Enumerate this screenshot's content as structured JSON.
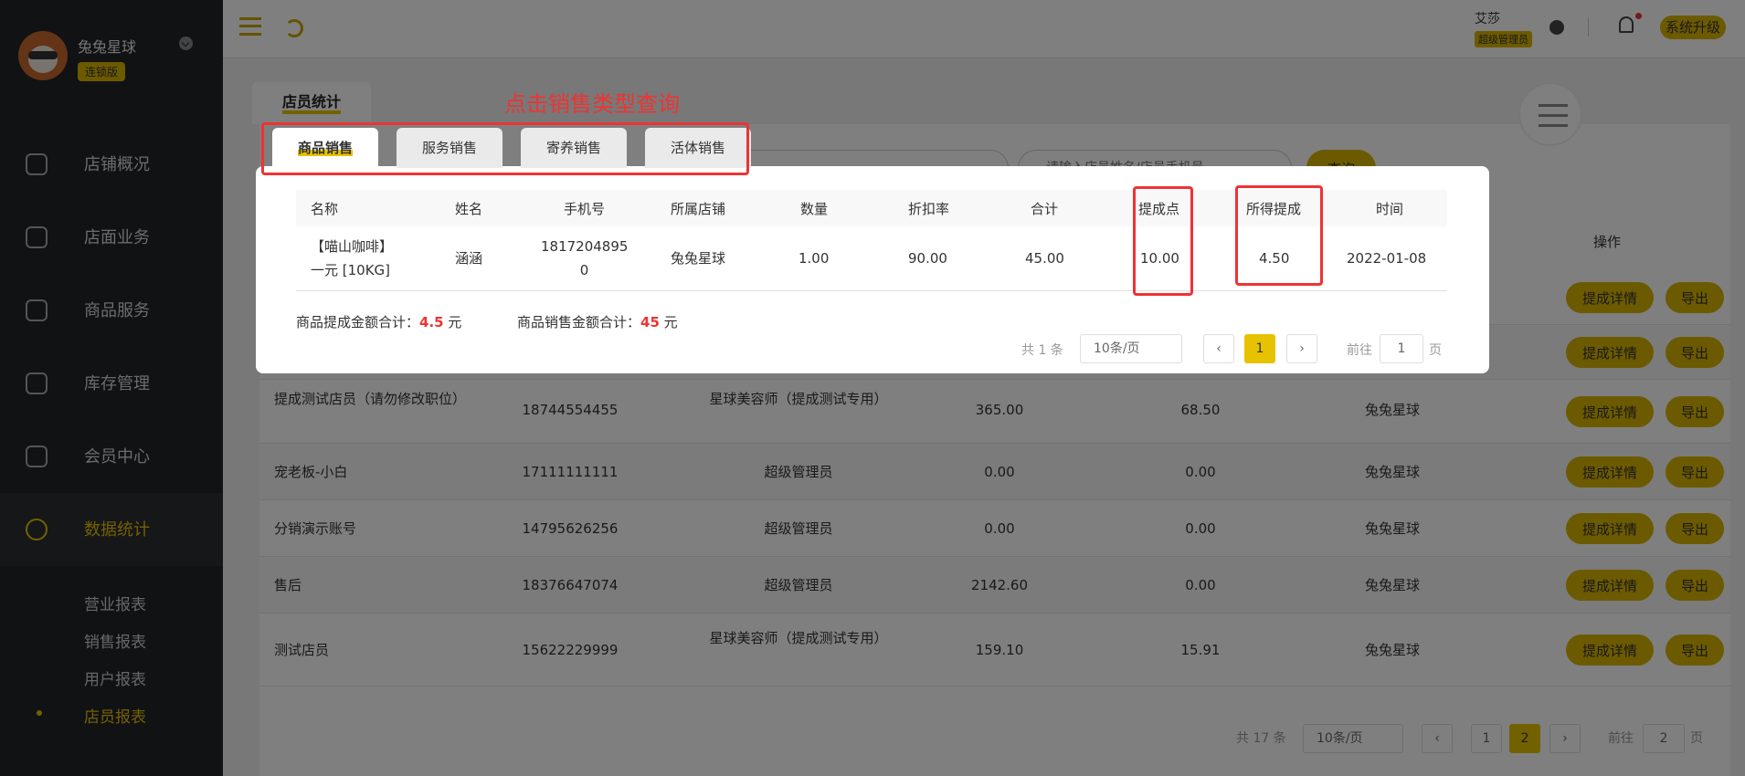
{
  "sidebar": {
    "store_name": "兔兔星球",
    "edition": "连锁版",
    "items": [
      {
        "label": "店铺概况",
        "icon": "monitor-icon"
      },
      {
        "label": "店面业务",
        "icon": "home-icon"
      },
      {
        "label": "商品服务",
        "icon": "bag-icon"
      },
      {
        "label": "库存管理",
        "icon": "box-icon"
      },
      {
        "label": "会员中心",
        "icon": "headset-icon"
      },
      {
        "label": "数据统计",
        "icon": "chart-icon"
      }
    ],
    "sub_items": [
      "营业报表",
      "销售报表",
      "用户报表",
      "店员报表"
    ]
  },
  "topbar": {
    "user_name": "艾莎",
    "user_role": "超级管理员",
    "upgrade_label": "系统升级"
  },
  "main": {
    "tab_label": "店员统计",
    "search_placeholder": "请输入店员姓名/店员手机号",
    "search_label": "查询",
    "col_action": "操作",
    "rows": [
      {
        "name": "",
        "phone": "",
        "role": "",
        "sales": "",
        "commission": "",
        "store": ""
      },
      {
        "name": "",
        "phone": "",
        "role": "",
        "sales": "",
        "commission": "",
        "store": ""
      },
      {
        "name": "提成测试店员（请勿修改职位）",
        "phone": "18744554455",
        "role": "星球美容师（提成测试专用）",
        "sales": "365.00",
        "commission": "68.50",
        "store": "兔兔星球"
      },
      {
        "name": "宠老板-小白",
        "phone": "17111111111",
        "role": "超级管理员",
        "sales": "0.00",
        "commission": "0.00",
        "store": "兔兔星球"
      },
      {
        "name": "分销演示账号",
        "phone": "14795626256",
        "role": "超级管理员",
        "sales": "0.00",
        "commission": "0.00",
        "store": "兔兔星球"
      },
      {
        "name": "售后",
        "phone": "18376647074",
        "role": "超级管理员",
        "sales": "2142.60",
        "commission": "0.00",
        "store": "兔兔星球"
      },
      {
        "name": "测试店员",
        "phone": "15622229999",
        "role": "星球美容师（提成测试专用）",
        "sales": "159.10",
        "commission": "15.91",
        "store": "兔兔星球"
      }
    ],
    "detail_label": "提成详情",
    "export_label": "导出",
    "pager": {
      "total": "共 17 条",
      "size": "10条/页",
      "pages": [
        "1",
        "2"
      ],
      "goto": "前往",
      "goto_value": "2",
      "page_unit": "页"
    }
  },
  "modal": {
    "tabs": [
      "商品销售",
      "服务销售",
      "寄养销售",
      "活体销售"
    ],
    "annotation": "点击销售类型查询",
    "columns": [
      "名称",
      "姓名",
      "手机号",
      "所属店铺",
      "数量",
      "折扣率",
      "合计",
      "提成点",
      "所得提成",
      "时间"
    ],
    "row": {
      "product_line1": "【喵山咖啡】",
      "product_line2": "一元 [10KG]",
      "name": "涵涵",
      "phone_line1": "1817204895",
      "phone_line2": "0",
      "store": "兔兔星球",
      "qty": "1.00",
      "discount": "90.00",
      "total": "45.00",
      "rate": "10.00",
      "commission": "4.50",
      "date": "2022-01-08"
    },
    "sum_commission_label": "商品提成金额合计：",
    "sum_commission_value": "4.5",
    "sum_sales_label": "商品销售金额合计：",
    "sum_sales_value": "45",
    "unit": "元",
    "pager": {
      "total": "共 1 条",
      "size": "10条/页",
      "page": "1",
      "goto": "前往",
      "goto_value": "1",
      "page_unit": "页"
    }
  },
  "colors": {
    "accent": "#e7c200",
    "annotation": "#e33333",
    "sidebar": "#222428"
  }
}
